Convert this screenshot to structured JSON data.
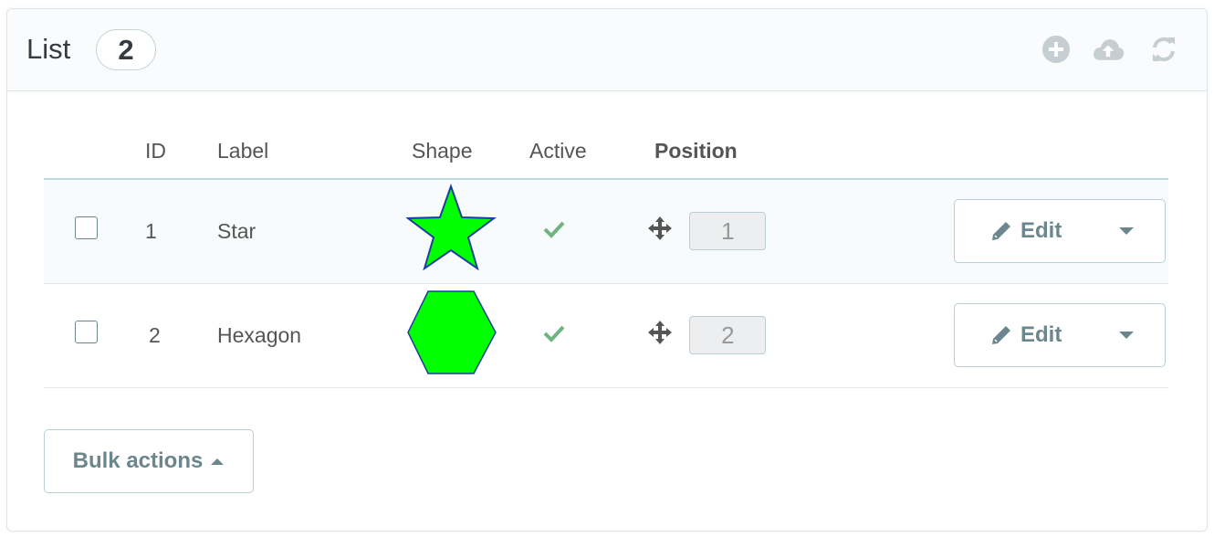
{
  "panel": {
    "title": "List",
    "count": "2"
  },
  "toolbar": {
    "add_icon": "plus-circle-icon",
    "export_icon": "cloud-upload-icon",
    "refresh_icon": "refresh-icon",
    "icon_color": "#c7ced1"
  },
  "table": {
    "columns": [
      "",
      "ID",
      "Label",
      "Shape",
      "Active",
      "Position",
      ""
    ],
    "rows": [
      {
        "id": "1",
        "label": "Star",
        "shape": "star",
        "active": true,
        "position": "1",
        "edit_label": "Edit"
      },
      {
        "id": "2",
        "label": "Hexagon",
        "shape": "hexagon",
        "active": true,
        "position": "2",
        "edit_label": "Edit"
      }
    ]
  },
  "colors": {
    "shape_fill": "#00ff00",
    "shape_stroke": "#1a3fa0",
    "check": "#70b580",
    "accent_border": "#b9dbe4"
  },
  "bulk": {
    "label": "Bulk actions"
  }
}
